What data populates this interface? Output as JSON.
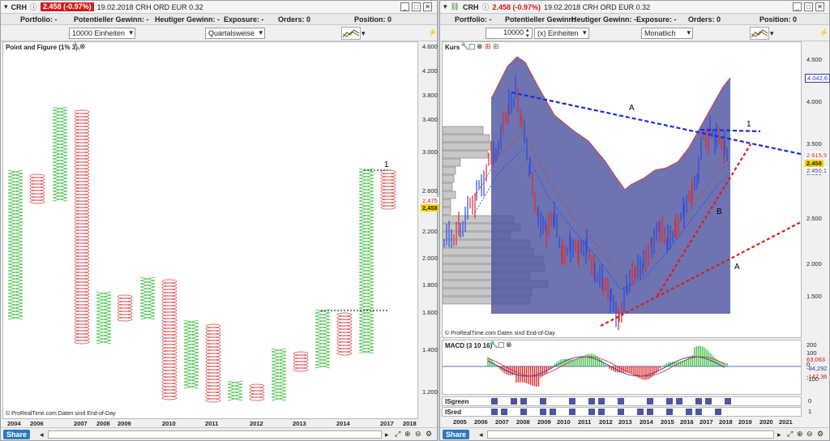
{
  "left": {
    "symbol": "CRH",
    "price_badge": "2.458 (-0.97%)",
    "date_info": "19.02.2018 CRH ORD EUR 0.32",
    "info": {
      "portfolio": "Portfolio: -",
      "pot_gain": "Potentieller Gewinn: -",
      "today_gain": "Heutiger Gewinn: -",
      "exposure": "Exposure: -",
      "orders": "Orders: 0",
      "position": "Position: 0"
    },
    "units_select": "10000 Einheiten",
    "period_select": "Quartalsweise",
    "chart_title": "Point and Figure (1% 3)",
    "watermark": "© ProRealTime.com  Daten sind End-of-Day",
    "label_1": "1",
    "price_tags": {
      "red": "2,475",
      "current": "2,458"
    },
    "y_ticks": [
      "4.600",
      "4.200",
      "3.800",
      "3.400",
      "3.000",
      "2.600",
      "2.200",
      "2.000",
      "1.800",
      "1.600",
      "1.400",
      "1.200"
    ],
    "x_years": [
      "2004",
      "2006",
      "2007",
      "2008",
      "2009",
      "2010",
      "2011",
      "2012",
      "2013",
      "2014",
      "2017",
      "2018"
    ],
    "share": "Share"
  },
  "right": {
    "symbol": "CRH",
    "price_badge": "2.458 (-0.97%)",
    "date_info": "19.02.2018 CRH ORD EUR 0.32",
    "info": {
      "portfolio": "Portfolio: -",
      "pot_gain": "Potentieller Gewinn: -",
      "today_gain": "Heutiger Gewinn: -",
      "exposure": "Exposure: -",
      "orders": "Orders: 0",
      "position": "Position: 0"
    },
    "units_value": "10000",
    "units_select": "(x) Einheiten",
    "period_select": "Monatlich",
    "price_title": "Kurs",
    "watermark": "© ProRealTime.com  Daten sind End-of-Day",
    "labels": {
      "A1": "A",
      "one": "1",
      "B": "B",
      "A2": "A"
    },
    "price_tags": {
      "top": "4.042,6",
      "red": "2.615,9",
      "current": "2.458",
      "blue": "2.450,1"
    },
    "y_ticks": [
      "4.500",
      "4.000",
      "3.500",
      "3.000",
      "2.500",
      "2.000",
      "1.500"
    ],
    "macd_title": "MACD (3 10 16)",
    "macd_ticks": [
      "200",
      "100",
      "0",
      "-100"
    ],
    "macd_tags": {
      "red": "63,063",
      "blue": "-84,292",
      "red2": "-147,36"
    },
    "isgreen": "ISgreen",
    "isred": "ISred",
    "isgreen_val": "0",
    "isred_val": "1",
    "x_years": [
      "2005",
      "2006",
      "2007",
      "2008",
      "2009",
      "2010",
      "2011",
      "2012",
      "2013",
      "2014",
      "2015",
      "2016",
      "2017",
      "2018",
      "2019",
      "2020",
      "2021"
    ],
    "share": "Share"
  }
}
